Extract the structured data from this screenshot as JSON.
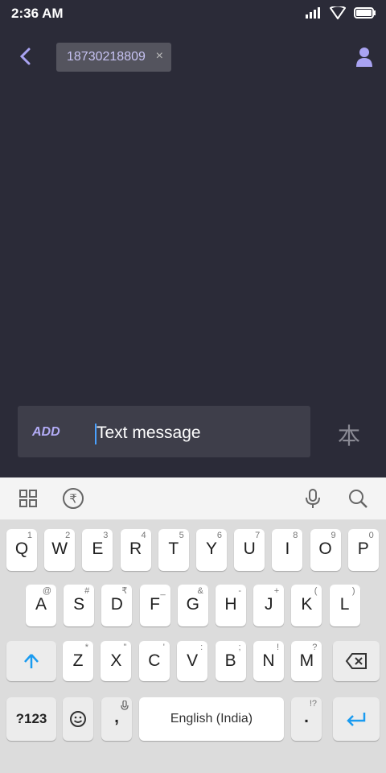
{
  "status": {
    "time": "2:36 AM"
  },
  "header": {
    "recipient": "18730218809",
    "remove_label": "×"
  },
  "composer": {
    "add_label": "ADD",
    "placeholder": "Text message"
  },
  "send_glyph": "本",
  "keyboard": {
    "row1": [
      {
        "key": "Q",
        "hint": "1"
      },
      {
        "key": "W",
        "hint": "2"
      },
      {
        "key": "E",
        "hint": "3"
      },
      {
        "key": "R",
        "hint": "4"
      },
      {
        "key": "T",
        "hint": "5"
      },
      {
        "key": "Y",
        "hint": "6"
      },
      {
        "key": "U",
        "hint": "7"
      },
      {
        "key": "I",
        "hint": "8"
      },
      {
        "key": "O",
        "hint": "9"
      },
      {
        "key": "P",
        "hint": "0"
      }
    ],
    "row2": [
      {
        "key": "A",
        "hint": "@"
      },
      {
        "key": "S",
        "hint": "#"
      },
      {
        "key": "D",
        "hint": "₹"
      },
      {
        "key": "F",
        "hint": "_"
      },
      {
        "key": "G",
        "hint": "&"
      },
      {
        "key": "H",
        "hint": "-"
      },
      {
        "key": "J",
        "hint": "+"
      },
      {
        "key": "K",
        "hint": "("
      },
      {
        "key": "L",
        "hint": ")"
      }
    ],
    "row3": [
      {
        "key": "Z",
        "hint": "*"
      },
      {
        "key": "X",
        "hint": "\""
      },
      {
        "key": "C",
        "hint": "'"
      },
      {
        "key": "V",
        "hint": ":"
      },
      {
        "key": "B",
        "hint": ";"
      },
      {
        "key": "N",
        "hint": "!"
      },
      {
        "key": "M",
        "hint": "?"
      }
    ],
    "symbols_label": "?123",
    "comma": ",",
    "space_label": "English (India)",
    "period": ".",
    "period_hint": "!?"
  },
  "colors": {
    "background": "#2b2b38",
    "accent": "#b3acf7",
    "enter": "#1a9bf0"
  }
}
